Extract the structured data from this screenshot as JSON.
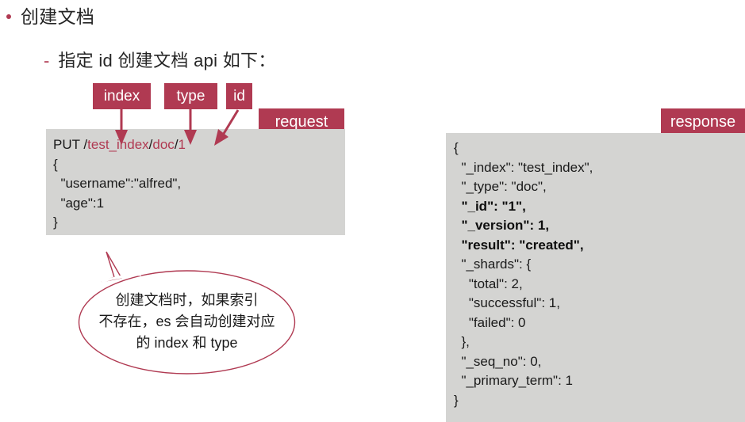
{
  "slide": {
    "bullet_level1": {
      "text": "创建文档",
      "marker": "•"
    },
    "bullet_level2": {
      "text": "指定 id 创建文档 api 如下：",
      "marker": "-"
    }
  },
  "tags": {
    "index": "index",
    "type": "type",
    "id": "id",
    "request": "request",
    "response": "response"
  },
  "request_block": {
    "lines": {
      "l1_method": "PUT ",
      "l1_slash1": "/",
      "l1_index": "test_index",
      "l1_slash2": "/",
      "l1_type": "doc",
      "l1_slash3": "/",
      "l1_id": "1",
      "l2": "{",
      "l3": "  \"username\":\"alfred\",",
      "l4": "  \"age\":1",
      "l5": "}"
    }
  },
  "response_block": {
    "lines": {
      "l1": "{",
      "l2": "  \"_index\": \"test_index\",",
      "l3": "  \"_type\": \"doc\",",
      "l4": "  \"_id\": \"1\",",
      "l5": "  \"_version\": 1,",
      "l6": "  \"result\": \"created\",",
      "l7": "  \"_shards\": {",
      "l8": "    \"total\": 2,",
      "l9": "    \"successful\": 1,",
      "l10": "    \"failed\": 0",
      "l11": "  },",
      "l12": "  \"_seq_no\": 0,",
      "l13": "  \"_primary_term\": 1",
      "l14": "}"
    }
  },
  "callout": {
    "text": "创建文档时，如果索引\n不存在，es 会自动创建对应\n的 index 和 type"
  },
  "colors": {
    "accent": "#B03A52",
    "code_bg": "#d4d4d2",
    "text": "#262626"
  }
}
